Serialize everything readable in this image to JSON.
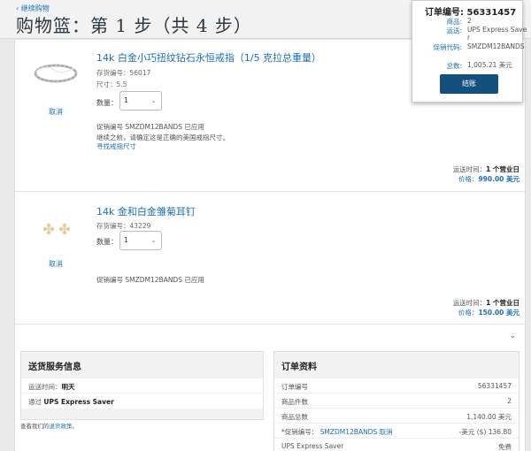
{
  "header": {
    "back_link": "‹ 继续购物",
    "title": "购物篮：第 1 步（共 4 步）"
  },
  "summary": {
    "order_label": "订单编号:",
    "order_no": "56331457",
    "rows": [
      {
        "k": "商品:",
        "v": "2"
      },
      {
        "k": "运送:",
        "v": "UPS Express Saver"
      },
      {
        "k": "促销代码:",
        "v": "SMZDM12BANDS"
      },
      {
        "k": "总数:",
        "v": "1,005.21 美元"
      }
    ],
    "checkout_label": "结账"
  },
  "items": [
    {
      "name": "14k 白金小巧扭纹钻石永恒戒指（1/5 克拉总重量）",
      "sku": "存货编号：56017",
      "size": "尺寸：5.5",
      "qty_label": "数量：",
      "qty": "1",
      "cancel": "取消",
      "promo": "促销编号 SMZDM12BANDS 已应用",
      "note": "继续之前，请确定这是正确的美国戒指尺寸。",
      "size_link": "寻找戒指尺寸",
      "ship_label": "运送时间：",
      "ship_value": "1 个营业日",
      "price_label": "价格：",
      "price_value": "990.00 美元"
    },
    {
      "name": "14k 金和白金雏菊耳钉",
      "sku": "存货编号：43229",
      "qty_label": "数量：",
      "qty": "1",
      "cancel": "取消",
      "promo": "促销编号 SMZDM12BANDS 已应用",
      "ship_label": "运送时间：",
      "ship_value": "1 个营业日",
      "price_label": "价格：",
      "price_value": "150.00 美元"
    }
  ],
  "shipping_panel": {
    "title": "送货服务信息",
    "time_label": "运送时间：",
    "time_value": "明天",
    "via_label": "通过 ",
    "via_value": "UPS Express Saver"
  },
  "returns": {
    "prefix": "查看我们的",
    "link": "退货政策",
    "suffix": "。"
  },
  "order_panel": {
    "title": "订单资料",
    "rows": [
      {
        "k": "订单编号",
        "v": "56331457"
      },
      {
        "k": "商品件数",
        "v": "2"
      },
      {
        "k": "商品总数",
        "v": "1,140.00 美元"
      },
      {
        "k": "*促销编号： ",
        "link": "SMZDM12BANDS 取消",
        "v": "-美元 ($) 136.80"
      },
      {
        "k": "UPS Express Saver",
        "v": "免费"
      }
    ]
  },
  "icons": {
    "collapse": "chevron-down-icon",
    "select": "chevron-down-icon"
  },
  "colors": {
    "link": "#1a6fb5",
    "button": "#14507e",
    "title": "#2b3540"
  }
}
